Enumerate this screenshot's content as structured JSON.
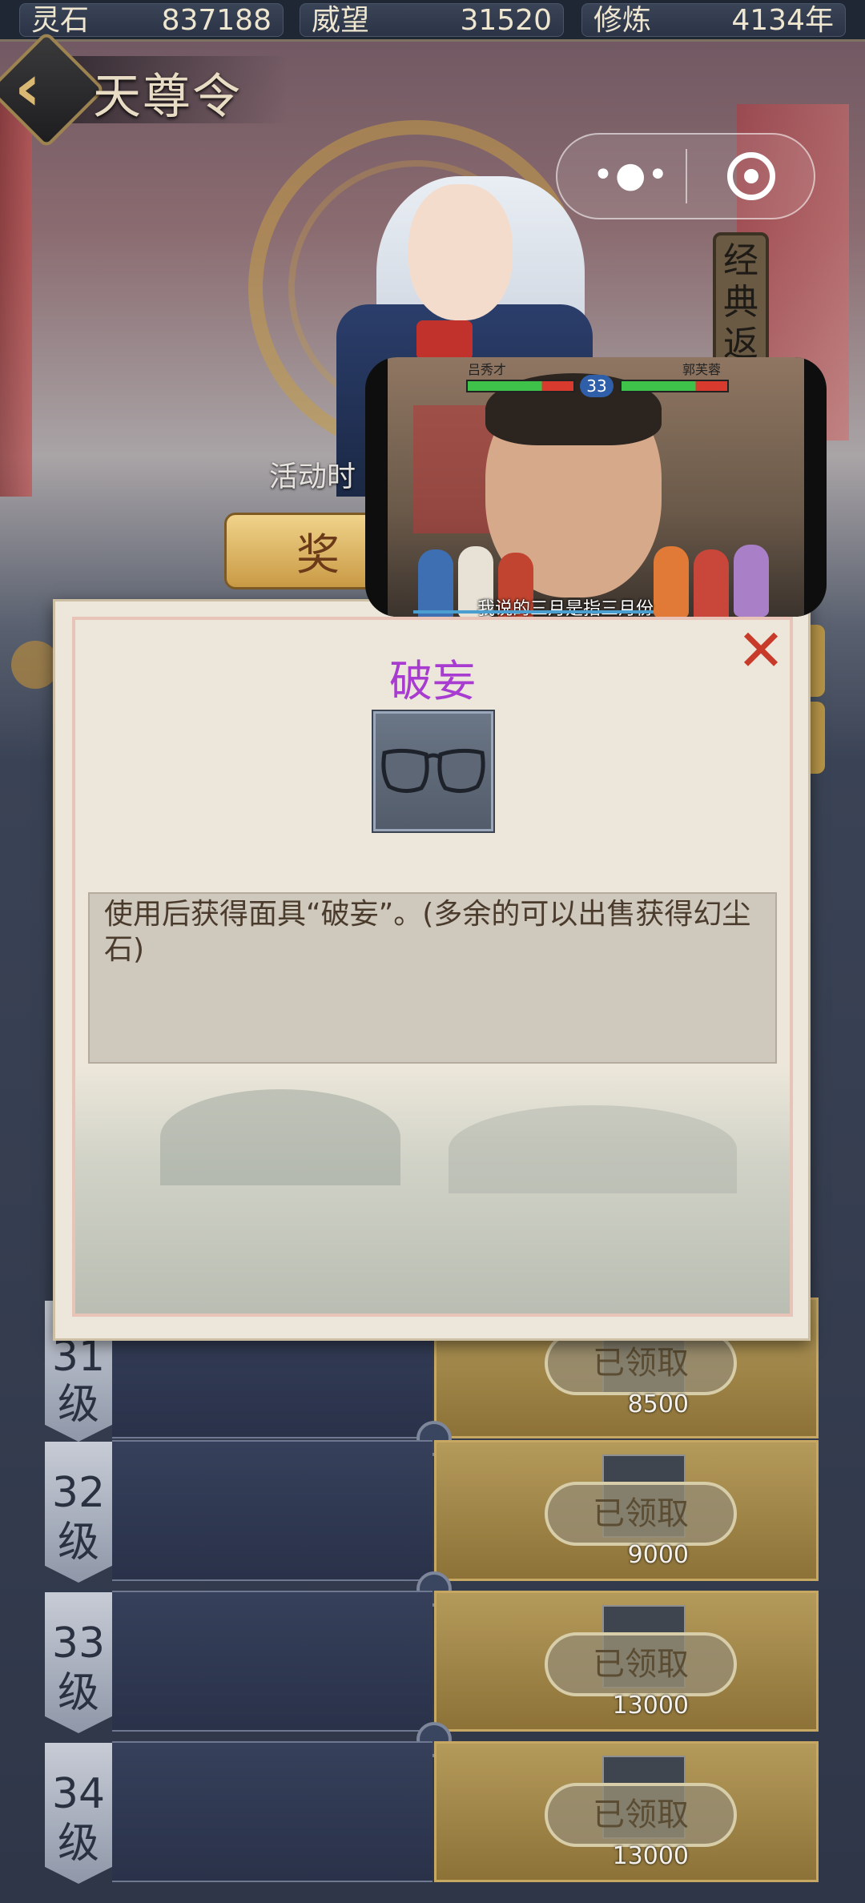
{
  "resources": [
    {
      "label": "灵石",
      "value": "837188"
    },
    {
      "label": "威望",
      "value": "31520"
    },
    {
      "label": "修炼",
      "value": "4134年"
    }
  ],
  "header": {
    "title": "天尊令"
  },
  "scroll_sign": "经典返",
  "activity_text": "活动时",
  "reward_button": "奖",
  "video": {
    "left_name": "吕秀才",
    "right_name": "郭芙蓉",
    "vs_level": "33",
    "subtitle": "我说的三月是指三月份"
  },
  "modal": {
    "title": "破妄",
    "description": "使用后获得面具“破妄”。(多余的可以出售获得幻尘石)",
    "close_icon": "close-x"
  },
  "levels": [
    {
      "num": "31",
      "unit": "级",
      "claim": "已领取",
      "qty": "8500"
    },
    {
      "num": "32",
      "unit": "级",
      "claim": "已领取",
      "qty": "9000"
    },
    {
      "num": "33",
      "unit": "级",
      "claim": "已领取",
      "qty": "13000"
    },
    {
      "num": "34",
      "unit": "级",
      "claim": "已领取",
      "qty": "13000"
    }
  ],
  "colors": {
    "title_purple": "#a83cd0",
    "close_red": "#c83a2a",
    "gold": "#b49a5a"
  }
}
